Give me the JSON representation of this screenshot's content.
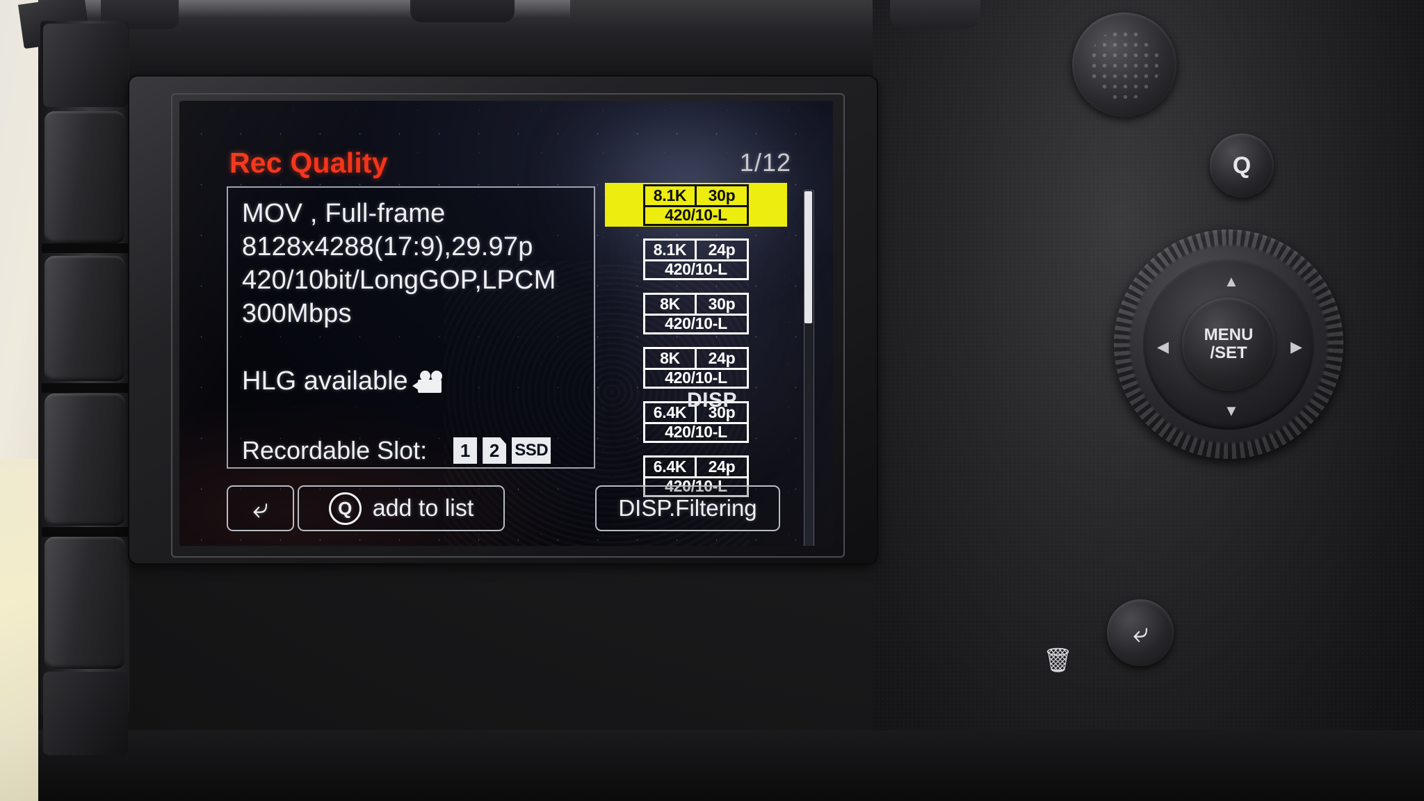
{
  "screen": {
    "title": "Rec Quality",
    "page_indicator": "1/12",
    "info": {
      "lines": [
        "MOV , Full-frame",
        "8128x4288(17:9),29.97p",
        "420/10bit/LongGOP,LPCM",
        "300Mbps"
      ],
      "hlg_label": "HLG available",
      "hlg_icon": "video-camera-icon",
      "slot_label": "Recordable Slot:",
      "slot_badges": [
        "1",
        "2",
        "SSD"
      ]
    },
    "options": [
      {
        "resolution": "8.1K",
        "framerate": "30p",
        "codec": "420/10-L",
        "selected": true
      },
      {
        "resolution": "8.1K",
        "framerate": "24p",
        "codec": "420/10-L",
        "selected": false
      },
      {
        "resolution": "8K",
        "framerate": "30p",
        "codec": "420/10-L",
        "selected": false
      },
      {
        "resolution": "8K",
        "framerate": "24p",
        "codec": "420/10-L",
        "selected": false
      },
      {
        "resolution": "6.4K",
        "framerate": "30p",
        "codec": "420/10-L",
        "selected": false
      },
      {
        "resolution": "6.4K",
        "framerate": "24p",
        "codec": "420/10-L",
        "selected": false
      }
    ],
    "buttons": {
      "back_icon": "back-arrow-icon",
      "q_icon": "q-button-icon",
      "add_to_list": "add to list",
      "disp_filtering": "DISP.Filtering"
    },
    "colors": {
      "title": "#f4341a",
      "highlight": "#eded10",
      "text": "#eef0f2",
      "panel_border": "#9fa3ad"
    }
  },
  "camera": {
    "controls": {
      "q_button": "Q",
      "menu_set_line1": "MENU",
      "menu_set_line2": "/SET",
      "disp_button": "DISP",
      "back_button_icon": "back-arrow-icon",
      "trash_icon": "trash-icon",
      "arrow_up": "▲",
      "arrow_down": "▼",
      "arrow_left": "◀",
      "arrow_right": "▶"
    }
  }
}
